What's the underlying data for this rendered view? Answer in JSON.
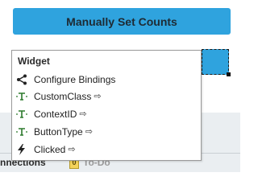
{
  "top_button": {
    "label": "Manually Set Counts"
  },
  "context_menu": {
    "header": "Widget",
    "items": [
      {
        "label": "Configure Bindings",
        "icon": "branch-icon",
        "has_arrow": false
      },
      {
        "label": "CustomClass",
        "icon": "text-field-icon",
        "has_arrow": true
      },
      {
        "label": "ContextID",
        "icon": "text-field-icon",
        "has_arrow": true
      },
      {
        "label": "ButtonType",
        "icon": "text-field-icon",
        "has_arrow": true
      },
      {
        "label": "Clicked",
        "icon": "lightning-icon",
        "has_arrow": true
      }
    ],
    "arrow_glyph": "⇨"
  },
  "bottom_tabs": {
    "connections": "nnections",
    "todo_label": "To-Do",
    "todo_count": "0"
  },
  "colors": {
    "accent_blue": "#2fa3de",
    "menu_bg": "#ffffff",
    "bottom_bg": "#eaeef1"
  }
}
